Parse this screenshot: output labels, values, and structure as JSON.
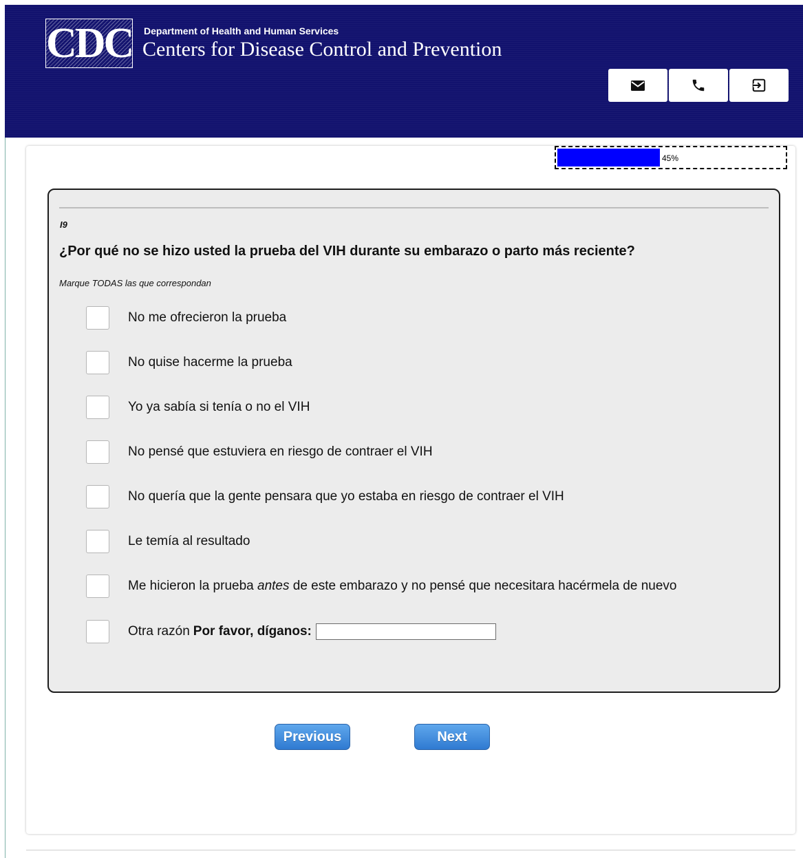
{
  "header": {
    "logo_text": "CDC",
    "department": "Department of Health and Human Services",
    "agency_name": "Centers for Disease Control and Prevention",
    "background_color": "#12126e",
    "buttons": [
      {
        "name": "email",
        "icon": "mail-icon"
      },
      {
        "name": "phone",
        "icon": "phone-icon"
      },
      {
        "name": "exit",
        "icon": "exit-icon"
      }
    ]
  },
  "progress": {
    "percent": 45,
    "label": "45%",
    "fill_color": "#0000ff"
  },
  "question": {
    "id": "I9",
    "text": "¿Por qué no se hizo usted la prueba del VIH durante su embarazo o parto más reciente?",
    "instruction": "Marque TODAS las que correspondan",
    "options": [
      {
        "label": "No me ofrecieron la prueba",
        "checked": false
      },
      {
        "label": "No quise hacerme la prueba",
        "checked": false
      },
      {
        "label": "Yo ya sabía si tenía o no el VIH",
        "checked": false
      },
      {
        "label": "No pensé que estuviera en riesgo de contraer el VIH",
        "checked": false
      },
      {
        "label": "No quería que la gente pensara que yo estaba en riesgo de contraer el VIH",
        "checked": false
      },
      {
        "label": "Le temía al resultado",
        "checked": false
      },
      {
        "label_before": "Me hicieron la prueba",
        "label_emphasis": "antes",
        "label_after": "de este embarazo y no pensé que necesitara hacérmela de nuevo",
        "checked": false
      },
      {
        "label": "Otra razón",
        "label_bold": "Por favor, díganos:",
        "checked": false,
        "other_value": ""
      }
    ]
  },
  "navigation": {
    "previous_label": "Previous",
    "next_label": "Next",
    "button_color": "#3b86dc"
  }
}
